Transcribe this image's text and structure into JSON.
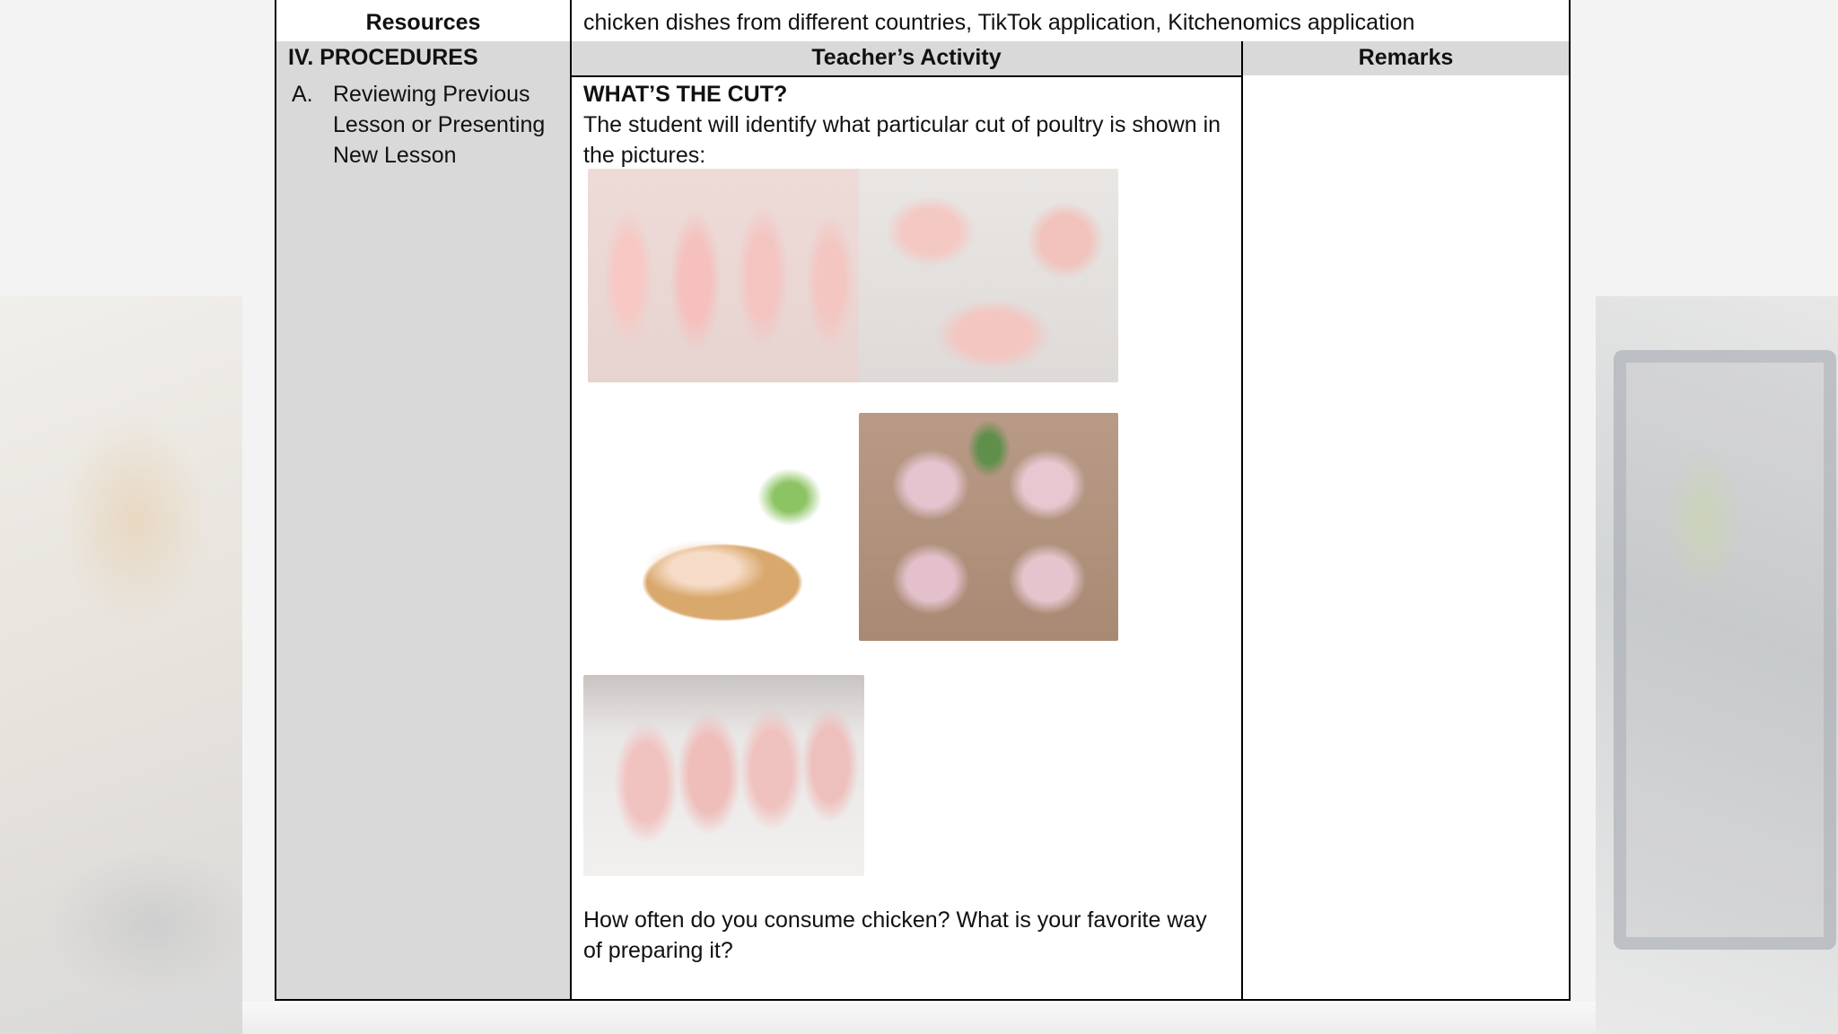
{
  "top_row": {
    "label": "Resources",
    "text": "chicken dishes from different countries, TikTok application, Kitchenomics application"
  },
  "header": {
    "col1": "IV. PROCEDURES",
    "col2": "Teacher’s Activity",
    "col3": "Remarks"
  },
  "procedure": {
    "letter": "A.",
    "title": "Reviewing Previous Lesson or Presenting New Lesson"
  },
  "activity": {
    "title": "WHAT’S THE CUT?",
    "instruction": "The student will identify what particular cut of poultry is shown in the pictures:",
    "question": "How often do you consume chicken? What is your favorite way of preparing it?"
  },
  "images": [
    {
      "name": "drumsticks-photo"
    },
    {
      "name": "wings-photo"
    },
    {
      "name": "leg-quarters-photo"
    },
    {
      "name": "thighs-photo"
    },
    {
      "name": "breast-photo"
    }
  ]
}
